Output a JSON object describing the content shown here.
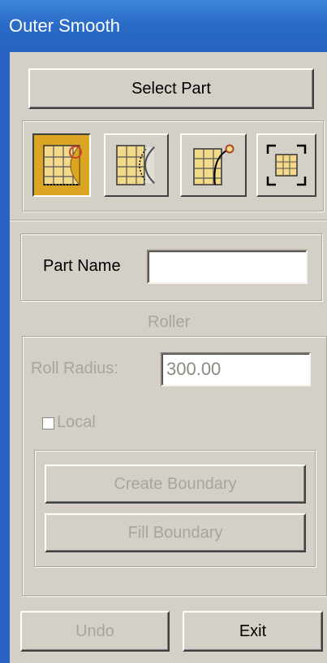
{
  "window": {
    "title": "Outer Smooth"
  },
  "select_part": {
    "label": "Select Part"
  },
  "mode_icons": [
    {
      "icon": "outer-smooth-corner-icon",
      "active": true
    },
    {
      "icon": "inner-arc-boundary-icon",
      "active": false
    },
    {
      "icon": "corner-point-arc-icon",
      "active": false
    },
    {
      "icon": "fit-grid-frame-icon",
      "active": false
    }
  ],
  "part": {
    "label": "Part Name",
    "value": ""
  },
  "roller": {
    "heading": "Roller",
    "radius_label": "Roll Radius:",
    "radius_value": "300.00",
    "local_label": "Local",
    "local_checked": false,
    "create_boundary": "Create Boundary",
    "fill_boundary": "Fill Boundary"
  },
  "footer": {
    "undo": "Undo",
    "exit": "Exit"
  },
  "colors": {
    "title_bar": "#2a6cc8",
    "active_icon": "#d9a522",
    "panel": "#d4d0c8"
  }
}
